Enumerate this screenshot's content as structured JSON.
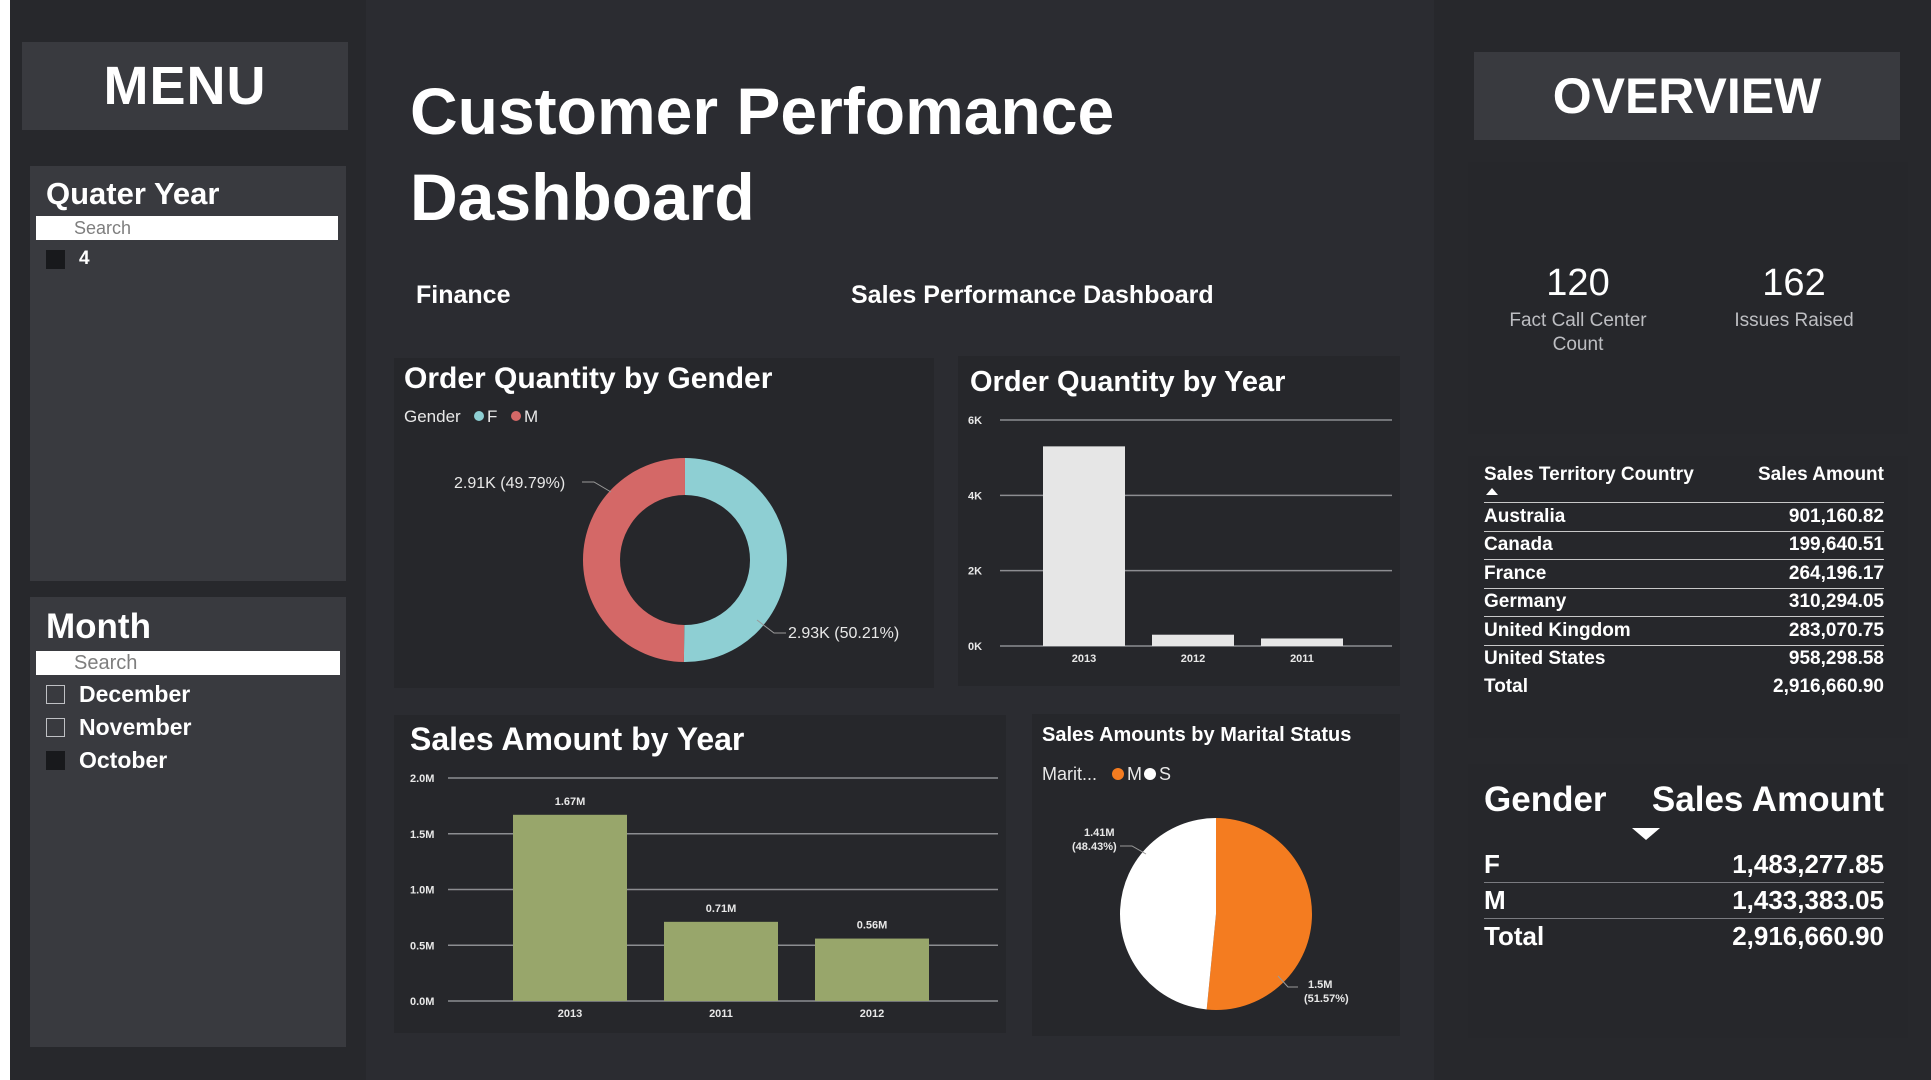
{
  "menu": {
    "title": "MENU"
  },
  "quarter_slicer": {
    "title": "Quater Year",
    "search_placeholder": "Search",
    "options": [
      {
        "label": "4",
        "checked": true
      }
    ]
  },
  "month_slicer": {
    "title": "Month",
    "search_placeholder": "Search",
    "options": [
      {
        "label": "December",
        "checked": false
      },
      {
        "label": "November",
        "checked": false
      },
      {
        "label": "October",
        "checked": true
      }
    ]
  },
  "header": {
    "title_line1": "Customer Perfomance",
    "title_line2": "Dashboard",
    "finance_label": "Finance",
    "sales_dashboard_label": "Sales Performance Dashboard"
  },
  "overview": {
    "title": "OVERVIEW",
    "kpis": [
      {
        "value": "120",
        "label_line1": "Fact Call Center",
        "label_line2": "Count"
      },
      {
        "value": "162",
        "label_line1": "Issues Raised",
        "label_line2": ""
      }
    ]
  },
  "territory_table": {
    "columns": [
      "Sales Territory Country",
      "Sales Amount"
    ],
    "rows": [
      [
        "Australia",
        "901,160.82"
      ],
      [
        "Canada",
        "199,640.51"
      ],
      [
        "France",
        "264,196.17"
      ],
      [
        "Germany",
        "310,294.05"
      ],
      [
        "United Kingdom",
        "283,070.75"
      ],
      [
        "United States",
        "958,298.58"
      ]
    ],
    "total": [
      "Total",
      "2,916,660.90"
    ]
  },
  "gender_table": {
    "columns": [
      "Gender",
      "Sales Amount"
    ],
    "rows": [
      [
        "F",
        "1,483,277.85"
      ],
      [
        "M",
        "1,433,383.05"
      ]
    ],
    "total": [
      "Total",
      "2,916,660.90"
    ]
  },
  "colors": {
    "female": "#8ecfd3",
    "male": "#d46867",
    "olive": "#98a66b",
    "bar_light": "#e6e6e6",
    "orange": "#f47c20",
    "white": "#ffffff"
  },
  "chart_data": [
    {
      "id": "gender_donut",
      "type": "pie",
      "title": "Order Quantity by Gender",
      "legend_title": "Gender",
      "legend": [
        "F",
        "M"
      ],
      "slices": [
        {
          "name": "F",
          "value": 2930,
          "percent": 50.21,
          "label": "2.93K (50.21%)"
        },
        {
          "name": "M",
          "value": 2910,
          "percent": 49.79,
          "label": "2.91K (49.79%)"
        }
      ]
    },
    {
      "id": "qty_year",
      "type": "bar",
      "title": "Order Quantity by Year",
      "categories": [
        "2013",
        "2012",
        "2011"
      ],
      "values": [
        5300,
        300,
        200
      ],
      "ylim": [
        0,
        6000
      ],
      "ticks": [
        0,
        2000,
        4000,
        6000
      ],
      "tick_labels": [
        "0K",
        "2K",
        "4K",
        "6K"
      ]
    },
    {
      "id": "sales_year",
      "type": "bar",
      "title": "Sales Amount by Year",
      "categories": [
        "2013",
        "2011",
        "2012"
      ],
      "values": [
        1.67,
        0.71,
        0.56
      ],
      "labels": [
        "1.67M",
        "0.71M",
        "0.56M"
      ],
      "ylim": [
        0,
        2.0
      ],
      "ticks": [
        0,
        0.5,
        1.0,
        1.5,
        2.0
      ],
      "tick_labels": [
        "0.0M",
        "0.5M",
        "1.0M",
        "1.5M",
        "2.0M"
      ]
    },
    {
      "id": "marital_pie",
      "type": "pie",
      "title": "Sales Amounts by Marital Status",
      "legend_title": "Marit...",
      "legend": [
        "M",
        "S"
      ],
      "slices": [
        {
          "name": "M",
          "value": 1.5,
          "percent": 51.57,
          "label_line1": "1.5M",
          "label_line2": "(51.57%)"
        },
        {
          "name": "S",
          "value": 1.41,
          "percent": 48.43,
          "label_line1": "1.41M",
          "label_line2": "(48.43%)"
        }
      ]
    }
  ]
}
